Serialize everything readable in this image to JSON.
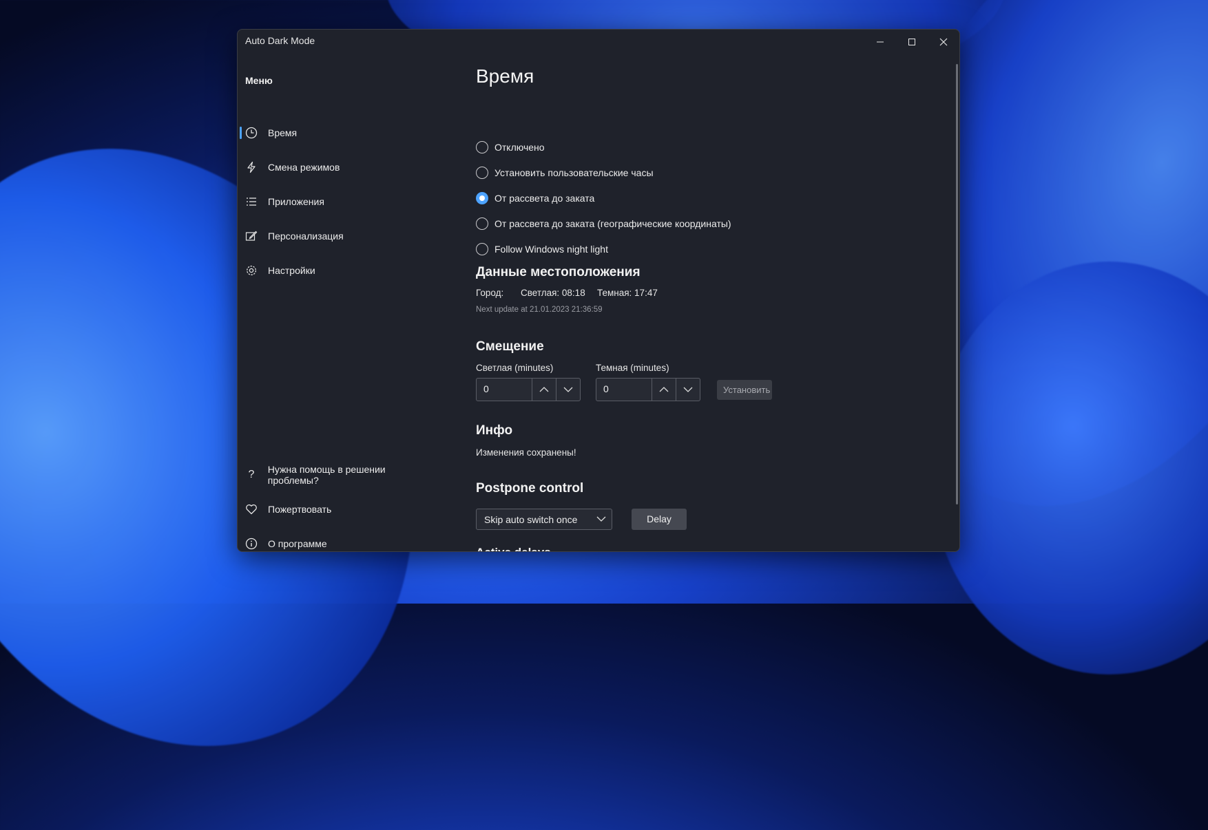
{
  "window": {
    "title": "Auto Dark Mode",
    "controls": {
      "minimize_icon": "minimize-icon",
      "maximize_icon": "maximize-icon",
      "close_icon": "close-icon"
    }
  },
  "sidebar": {
    "menu_title": "Меню",
    "items": [
      {
        "label": "Время",
        "icon": "clock-icon",
        "active": true
      },
      {
        "label": "Смена режимов",
        "icon": "lightning-icon",
        "active": false
      },
      {
        "label": "Приложения",
        "icon": "list-icon",
        "active": false
      },
      {
        "label": "Персонализация",
        "icon": "edit-icon",
        "active": false
      },
      {
        "label": "Настройки",
        "icon": "gear-icon",
        "active": false
      }
    ],
    "footer_items": [
      {
        "label": "Нужна помощь в решении проблемы?",
        "icon": "help-icon"
      },
      {
        "label": "Пожертвовать",
        "icon": "heart-icon"
      },
      {
        "label": "О программе",
        "icon": "info-icon"
      }
    ]
  },
  "main": {
    "title": "Время",
    "radio_options": [
      {
        "label": "Отключено",
        "selected": false
      },
      {
        "label": "Установить пользовательские часы",
        "selected": false
      },
      {
        "label": "От рассвета до заката",
        "selected": true
      },
      {
        "label": "От рассвета до заката (географические координаты)",
        "selected": false
      },
      {
        "label": "Follow Windows night light",
        "selected": false
      }
    ],
    "location": {
      "heading": "Данные местоположения",
      "city_label": "Город:",
      "light_time": "Светлая: 08:18",
      "dark_time": "Темная: 17:47",
      "next_update": "Next update at  21.01.2023 21:36:59"
    },
    "offset": {
      "heading": "Смещение",
      "light_label": "Светлая (minutes)",
      "light_value": "0",
      "dark_label": "Темная (minutes)",
      "dark_value": "0",
      "set_button": "Установить"
    },
    "info": {
      "heading": "Инфо",
      "message": "Изменения сохранены!"
    },
    "postpone": {
      "heading": "Postpone control",
      "dropdown_value": "Skip auto switch once",
      "delay_button": "Delay",
      "next_heading": "Active delays"
    }
  },
  "colors": {
    "accent": "#4da3ff",
    "window_bg": "#1f222b"
  }
}
